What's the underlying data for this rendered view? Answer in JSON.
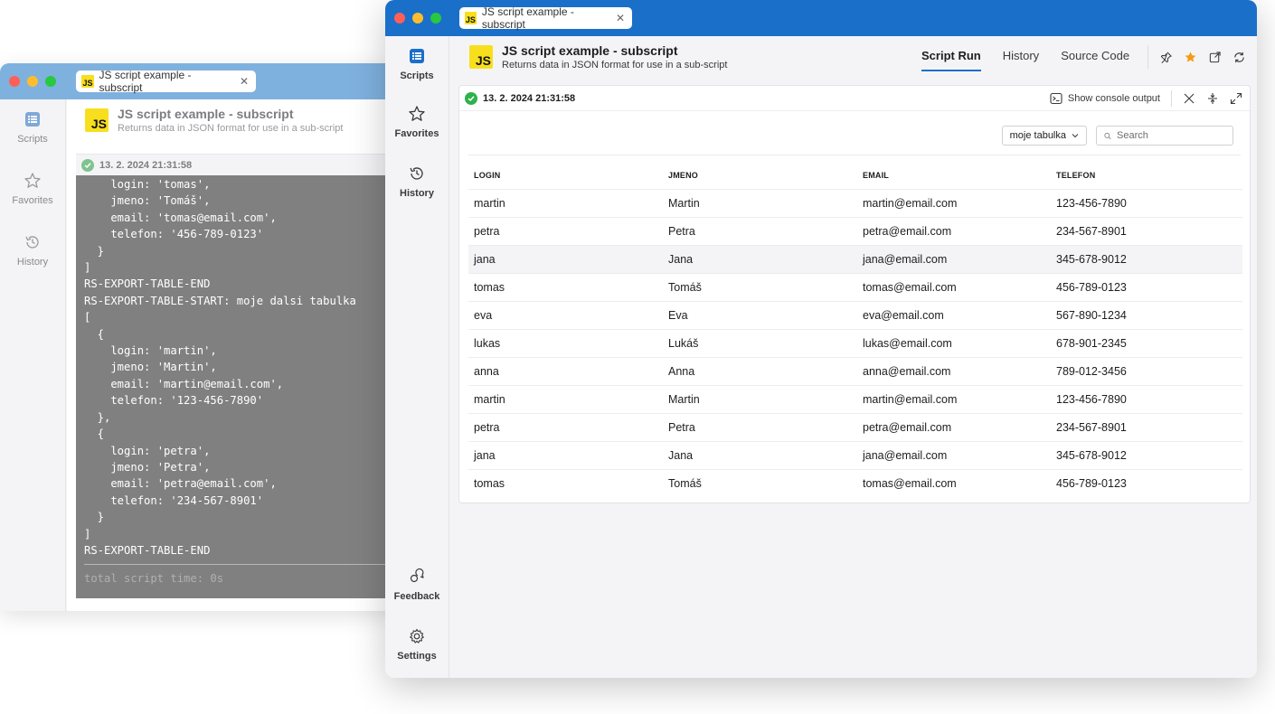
{
  "back_window": {
    "tab_title": "JS script example - subscript",
    "sidebar": [
      {
        "label": "Scripts",
        "icon": "list-icon"
      },
      {
        "label": "Favorites",
        "icon": "star-icon"
      },
      {
        "label": "History",
        "icon": "history-icon"
      }
    ],
    "header": {
      "title": "JS script example - subscript",
      "subtitle": "Returns data in JSON format for use in a sub-script"
    },
    "status": "13. 2. 2024 21:31:58",
    "console_lines": [
      "    login: 'tomas',",
      "    jmeno: 'Tomáš',",
      "    email: 'tomas@email.com',",
      "    telefon: '456-789-0123'",
      "  }",
      "]",
      "RS-EXPORT-TABLE-END",
      "RS-EXPORT-TABLE-START: moje dalsi tabulka",
      "[",
      "  {",
      "    login: 'martin',",
      "    jmeno: 'Martin',",
      "    email: 'martin@email.com',",
      "    telefon: '123-456-7890'",
      "  },",
      "  {",
      "    login: 'petra',",
      "    jmeno: 'Petra',",
      "    email: 'petra@email.com',",
      "    telefon: '234-567-8901'",
      "  }",
      "]",
      "RS-EXPORT-TABLE-END"
    ],
    "console_footer": "total script time: 0s"
  },
  "front_window": {
    "tab_title": "JS script example - subscript",
    "sidebar": {
      "scripts": "Scripts",
      "favorites": "Favorites",
      "history": "History",
      "feedback": "Feedback",
      "settings": "Settings"
    },
    "header": {
      "badge": "JS",
      "title": "JS script example - subscript",
      "subtitle": "Returns data in JSON format for use in a sub-script"
    },
    "nav_tabs": [
      "Script Run",
      "History",
      "Source Code"
    ],
    "active_tab": "Script Run",
    "accent_color": "#1a6fc9",
    "favorite_color": "#f39c12",
    "status": {
      "timestamp": "13. 2. 2024 21:31:58",
      "console_button": "Show console output"
    },
    "table_select": "moje tabulka",
    "search": {
      "placeholder": "Search",
      "value": ""
    },
    "table": {
      "columns": [
        "LOGIN",
        "JMENO",
        "EMAIL",
        "TELEFON"
      ],
      "rows": [
        [
          "martin",
          "Martin",
          "martin@email.com",
          "123-456-7890"
        ],
        [
          "petra",
          "Petra",
          "petra@email.com",
          "234-567-8901"
        ],
        [
          "jana",
          "Jana",
          "jana@email.com",
          "345-678-9012"
        ],
        [
          "tomas",
          "Tomáš",
          "tomas@email.com",
          "456-789-0123"
        ],
        [
          "eva",
          "Eva",
          "eva@email.com",
          "567-890-1234"
        ],
        [
          "lukas",
          "Lukáš",
          "lukas@email.com",
          "678-901-2345"
        ],
        [
          "anna",
          "Anna",
          "anna@email.com",
          "789-012-3456"
        ],
        [
          "martin",
          "Martin",
          "martin@email.com",
          "123-456-7890"
        ],
        [
          "petra",
          "Petra",
          "petra@email.com",
          "234-567-8901"
        ],
        [
          "jana",
          "Jana",
          "jana@email.com",
          "345-678-9012"
        ],
        [
          "tomas",
          "Tomáš",
          "tomas@email.com",
          "456-789-0123"
        ]
      ],
      "highlighted_row": 2
    }
  }
}
